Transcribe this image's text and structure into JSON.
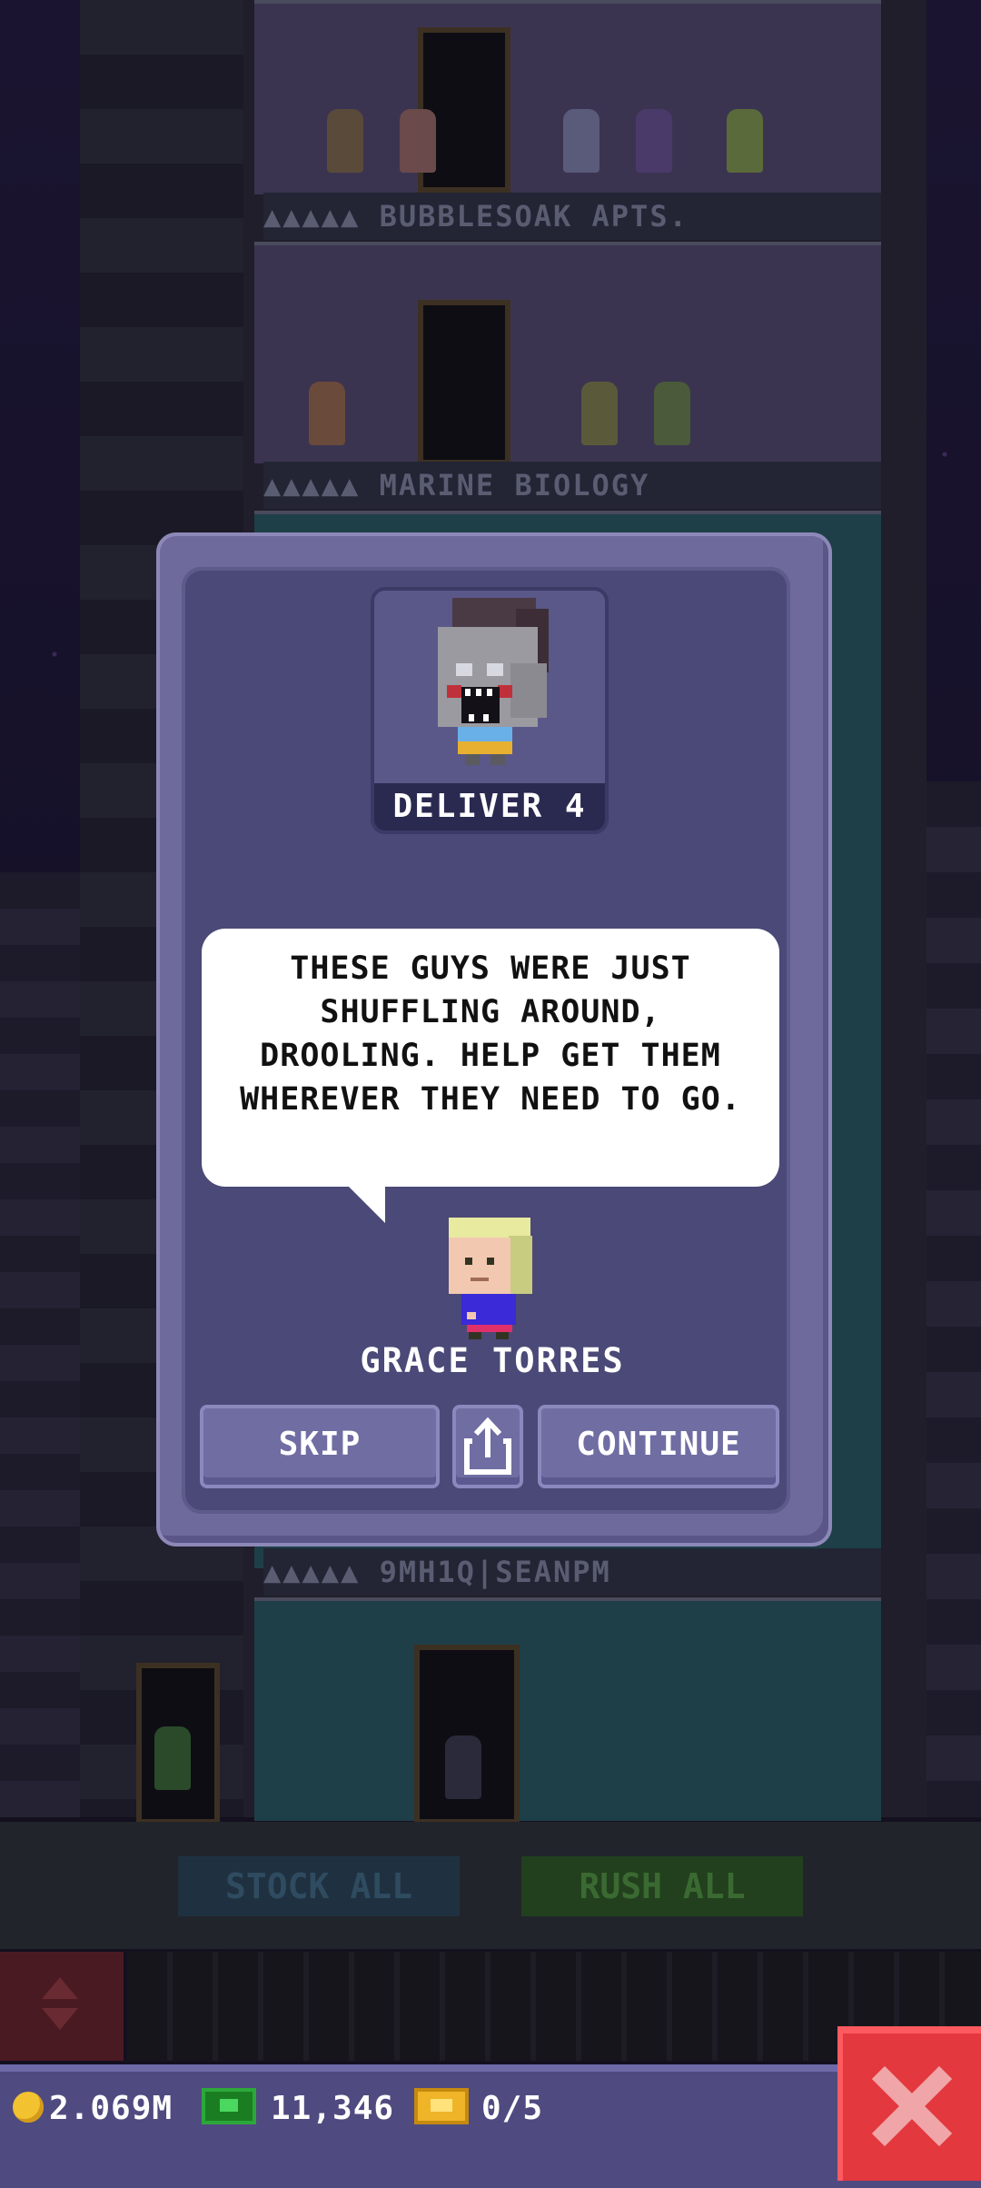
{
  "background": {
    "floors": [
      {
        "label": "▲▲▲▲▲ BUBBLESOAK APTS."
      },
      {
        "label": "▲▲▲▲▲ MARINE BIOLOGY"
      },
      {
        "label": "▲▲▲▲▲ 9MH1Q|SEANPM"
      }
    ],
    "stock_label": "STOCK ALL",
    "rush_label": "RUSH ALL"
  },
  "dialog": {
    "portrait_caption": "DELIVER 4",
    "speech": "THESE GUYS WERE JUST SHUFFLING AROUND, DROOLING. HELP GET THEM WHEREVER THEY NEED TO GO.",
    "speaker_name": "GRACE TORRES",
    "skip_label": "SKIP",
    "continue_label": "CONTINUE",
    "share_icon": "share-icon"
  },
  "resources": {
    "coins": "2.069M",
    "bux": "11,346",
    "tickets": "0/5"
  },
  "colors": {
    "dialog_frame": "#6e6b9c",
    "dialog_body": "#4b4977",
    "button": "#6f6da2",
    "close_button": "#e2383e",
    "resource_bar": "#4f4b80"
  }
}
